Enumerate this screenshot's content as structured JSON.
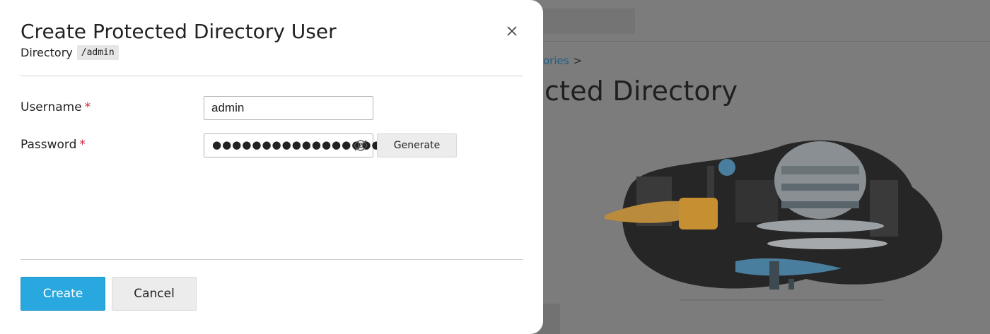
{
  "background": {
    "breadcrumb_partial": "ories",
    "breadcrumb_separator": ">",
    "page_title_partial": "cted Directory"
  },
  "modal": {
    "title": "Create Protected Directory User",
    "subtitle_label": "Directory",
    "directory_path": "/admin",
    "close_icon": "close-icon",
    "fields": {
      "username": {
        "label": "Username",
        "required_mark": "*",
        "value": "admin"
      },
      "password": {
        "label": "Password",
        "required_mark": "*",
        "masked_value": "●●●●●●●●●●●●●●●●●●●●",
        "visibility_icon": "eye-slash-icon"
      }
    },
    "generate_label": "Generate",
    "create_label": "Create",
    "cancel_label": "Cancel"
  },
  "colors": {
    "primary": "#29a8e0",
    "required": "#d0243c",
    "overlay": "#7c7c7c"
  }
}
